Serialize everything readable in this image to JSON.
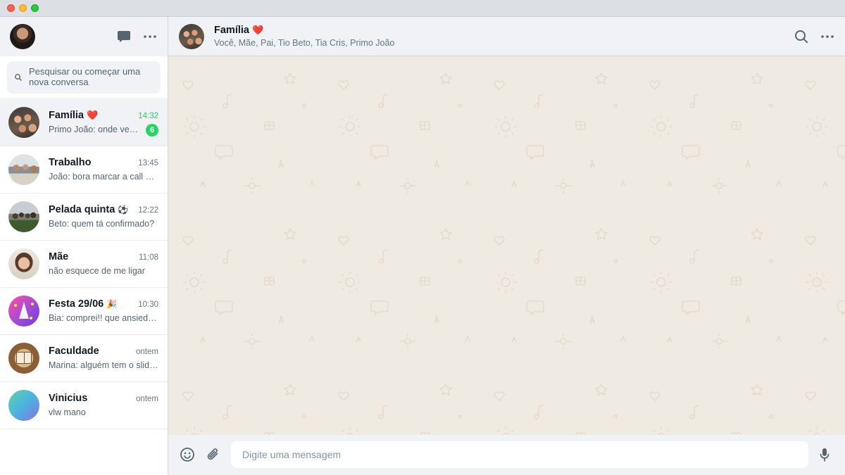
{
  "sidebar": {
    "search_placeholder": "Pesquisar ou começar uma nova conversa",
    "chats": [
      {
        "name": "Família",
        "emoji": "❤️",
        "time": "14:32",
        "preview": "Primo João: onde vem mais gente?",
        "unread": "6",
        "active": true
      },
      {
        "name": "Trabalho",
        "emoji": "",
        "time": "13:45",
        "preview": "João: bora marcar a call amanhã?",
        "unread": ""
      },
      {
        "name": "Pelada quinta",
        "emoji": "⚽",
        "time": "12:22",
        "preview": "Beto: quem tá confirmado?",
        "unread": ""
      },
      {
        "name": "Mãe",
        "emoji": "",
        "time": "11:08",
        "preview": "não esquece de me ligar",
        "unread": ""
      },
      {
        "name": "Festa 29/06",
        "emoji": "🎉",
        "time": "10:30",
        "preview": "Bia: comprei!! que ansiedade",
        "unread": ""
      },
      {
        "name": "Faculdade",
        "emoji": "",
        "time": "ontem",
        "preview": "Marina: alguém tem o slide da aula?",
        "unread": ""
      },
      {
        "name": "Vinicius",
        "emoji": "",
        "time": "ontem",
        "preview": "vlw mano",
        "unread": ""
      }
    ]
  },
  "conversation": {
    "name": "Família",
    "emoji": "❤️",
    "members": "Você, Mãe, Pai, Tio Beto, Tia Cris, Primo João"
  },
  "composer": {
    "placeholder": "Digite uma mensagem"
  },
  "colors": {
    "accent": "#25d366",
    "header_bg": "#f0f2f5",
    "wallpaper": "#efeae2",
    "wallpaper_doodle": "#e3d9c8"
  },
  "icons": [
    "chat-icon",
    "menu-dots-icon",
    "search-icon",
    "emoji-icon",
    "attach-icon",
    "mic-icon"
  ]
}
